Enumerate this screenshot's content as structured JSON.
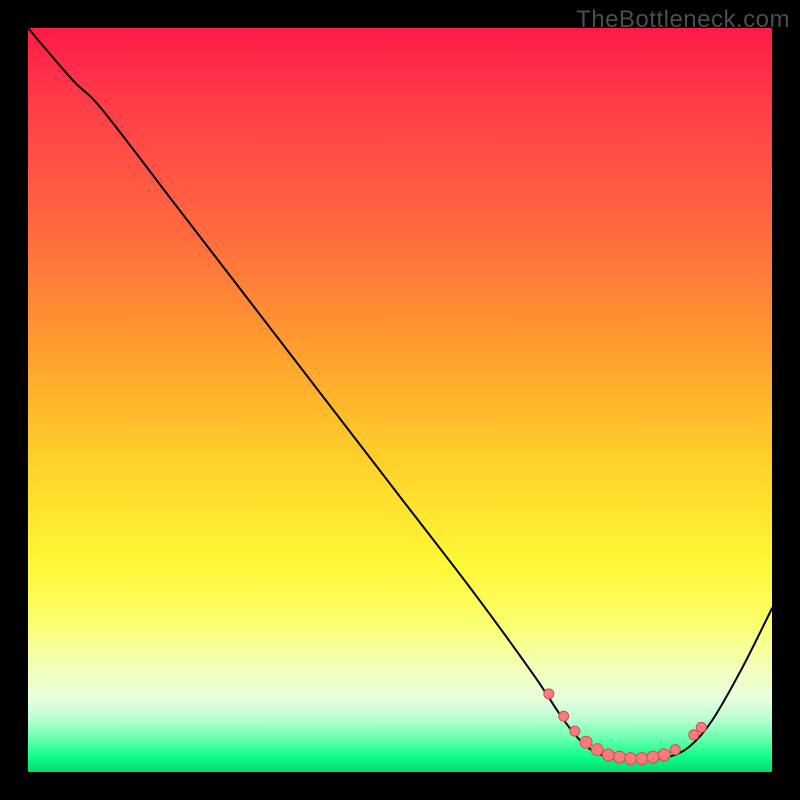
{
  "watermark": "TheBottleneck.com",
  "colors": {
    "stroke": "#000000",
    "marker_fill": "#f97b7c",
    "marker_stroke": "#d94a4c"
  },
  "chart_data": {
    "type": "line",
    "title": "",
    "xlabel": "",
    "ylabel": "",
    "xlim": [
      0,
      100
    ],
    "ylim": [
      0,
      100
    ],
    "note": "x is normalized position across plot; y is bottleneck percentage mapped to gradient (0=bottom/green, 100=top/red). No axis ticks visible.",
    "curve": [
      {
        "x": 0,
        "y": 100
      },
      {
        "x": 6,
        "y": 93
      },
      {
        "x": 10,
        "y": 89
      },
      {
        "x": 20,
        "y": 76
      },
      {
        "x": 30,
        "y": 63
      },
      {
        "x": 40,
        "y": 50
      },
      {
        "x": 50,
        "y": 37
      },
      {
        "x": 60,
        "y": 24
      },
      {
        "x": 68,
        "y": 13
      },
      {
        "x": 72,
        "y": 7
      },
      {
        "x": 75,
        "y": 3.5
      },
      {
        "x": 78,
        "y": 2
      },
      {
        "x": 82,
        "y": 1.7
      },
      {
        "x": 86,
        "y": 2
      },
      {
        "x": 89,
        "y": 3.5
      },
      {
        "x": 92,
        "y": 7
      },
      {
        "x": 96,
        "y": 14
      },
      {
        "x": 100,
        "y": 22
      }
    ],
    "markers": [
      {
        "x": 70,
        "y": 10.5,
        "r": 5
      },
      {
        "x": 72,
        "y": 7.5,
        "r": 5
      },
      {
        "x": 73.5,
        "y": 5.5,
        "r": 5
      },
      {
        "x": 75,
        "y": 4,
        "r": 6
      },
      {
        "x": 76.5,
        "y": 3,
        "r": 6
      },
      {
        "x": 78,
        "y": 2.3,
        "r": 6
      },
      {
        "x": 79.5,
        "y": 2,
        "r": 6
      },
      {
        "x": 81,
        "y": 1.8,
        "r": 6
      },
      {
        "x": 82.5,
        "y": 1.8,
        "r": 6
      },
      {
        "x": 84,
        "y": 2,
        "r": 6
      },
      {
        "x": 85.5,
        "y": 2.3,
        "r": 6
      },
      {
        "x": 87,
        "y": 3,
        "r": 5
      },
      {
        "x": 89.5,
        "y": 5,
        "r": 5
      },
      {
        "x": 90.5,
        "y": 6,
        "r": 5
      }
    ]
  }
}
